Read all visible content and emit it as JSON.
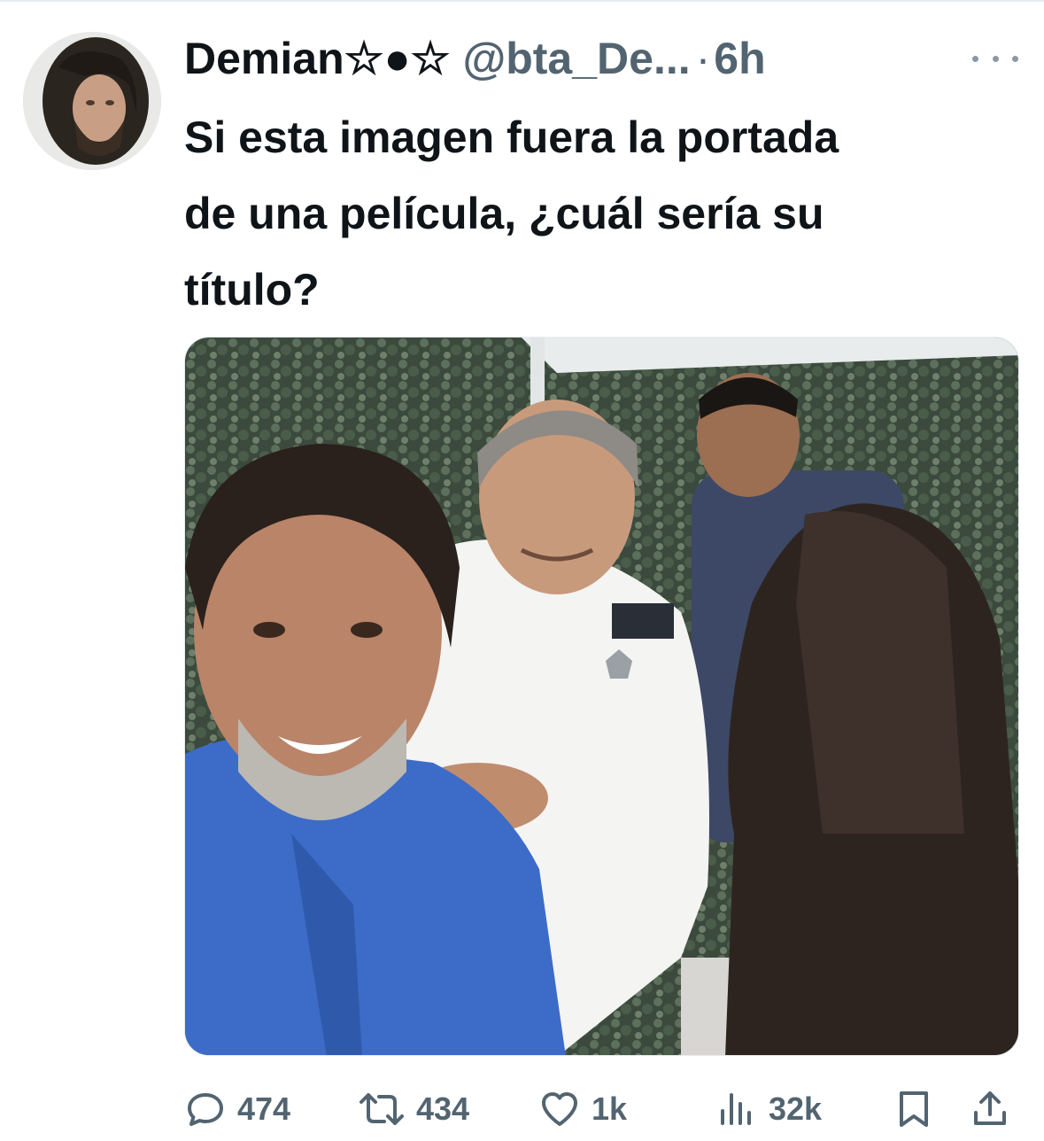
{
  "tweet": {
    "author": {
      "display_name": "Demian☆●☆",
      "handle": "@bta_De...",
      "avatar_icon": "profile-photo-icon"
    },
    "separator": "·",
    "time": "6h",
    "more_icon": "more-horizontal-icon",
    "text_lines": [
      "Si esta imagen fuera la portada",
      "de una película, ¿cuál sería su",
      "título?"
    ],
    "media": {
      "type": "photo"
    },
    "actions": {
      "reply": {
        "icon": "reply-icon",
        "count": "474"
      },
      "repost": {
        "icon": "repost-icon",
        "count": "434"
      },
      "like": {
        "icon": "heart-icon",
        "count": "1k"
      },
      "views": {
        "icon": "views-icon",
        "count": "32k"
      },
      "bookmark": {
        "icon": "bookmark-icon"
      },
      "share": {
        "icon": "share-icon"
      }
    }
  },
  "colors": {
    "text_primary": "#0f1419",
    "text_secondary": "#536471"
  }
}
